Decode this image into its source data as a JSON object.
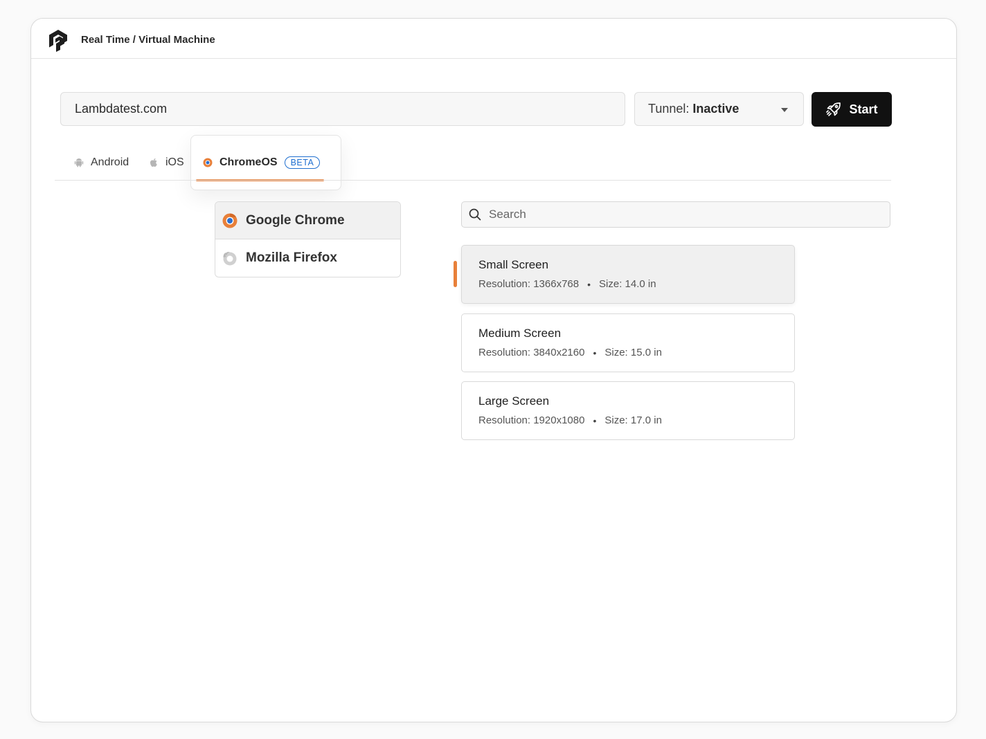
{
  "header": {
    "breadcrumb": "Real Time / Virtual Machine"
  },
  "toolbar": {
    "url_value": "Lambdatest.com",
    "tunnel_label": "Tunnel:",
    "tunnel_status": "Inactive",
    "start_label": "Start"
  },
  "os_tabs": {
    "android": "Android",
    "ios": "iOS",
    "chromeos": "ChromeOS",
    "chromeos_badge": "BETA",
    "selected": "ChromeOS"
  },
  "browsers": {
    "items": [
      {
        "label": "Google Chrome",
        "icon": "chrome-icon",
        "selected": true
      },
      {
        "label": "Mozilla Firefox",
        "icon": "firefox-icon",
        "selected": false
      }
    ]
  },
  "search": {
    "placeholder": "Search"
  },
  "screens": [
    {
      "name": "Small Screen",
      "resolution": "Resolution: 1366x768",
      "size": "Size: 14.0 in",
      "selected": true
    },
    {
      "name": "Medium Screen",
      "resolution": "Resolution: 3840x2160",
      "size": "Size: 15.0 in",
      "selected": false
    },
    {
      "name": "Large Screen",
      "resolution": "Resolution: 1920x1080",
      "size": "Size: 17.0 in",
      "selected": false
    }
  ],
  "colors": {
    "accent": "#e8803a",
    "beta": "#1f6fd0",
    "start_bg": "#111111"
  }
}
